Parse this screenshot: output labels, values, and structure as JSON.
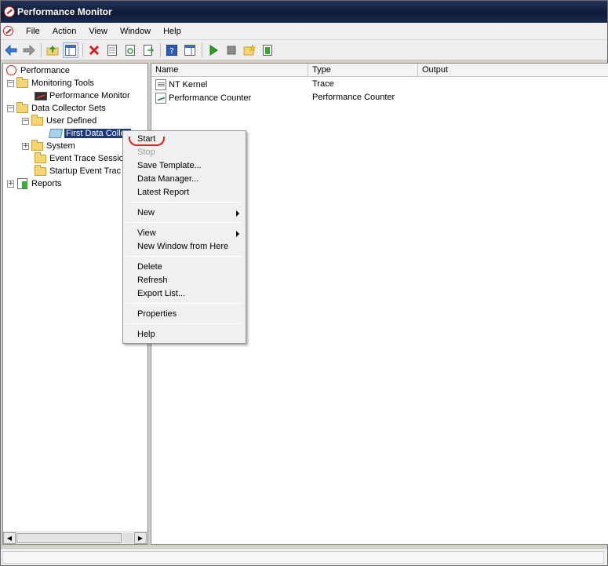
{
  "window": {
    "title": "Performance Monitor"
  },
  "menubar": {
    "items": [
      "File",
      "Action",
      "View",
      "Window",
      "Help"
    ]
  },
  "toolbar": {
    "buttons": [
      "back-icon",
      "forward-icon",
      "up-folder-icon",
      "show-hide-tree-icon",
      "delete-icon",
      "properties-icon",
      "refresh-icon",
      "export-icon",
      "help-icon",
      "show-action-pane-icon",
      "start-icon",
      "stop-icon",
      "new-collector-icon",
      "latest-report-icon"
    ]
  },
  "tree": {
    "root": "Performance",
    "monitoring_tools": "Monitoring Tools",
    "performance_monitor": "Performance Monitor",
    "data_collector_sets": "Data Collector Sets",
    "user_defined": "User Defined",
    "first_data_collector": "First Data Collec",
    "system": "System",
    "event_trace_sessions": "Event Trace Sessio",
    "startup_event_trace": "Startup Event Trac",
    "reports": "Reports"
  },
  "list": {
    "columns": [
      "Name",
      "Type",
      "Output"
    ],
    "rows": [
      {
        "name": "NT Kernel",
        "type": "Trace",
        "output": ""
      },
      {
        "name": "Performance Counter",
        "type": "Performance Counter",
        "output": ""
      }
    ]
  },
  "context_menu": {
    "start": "Start",
    "stop": "Stop",
    "save_template": "Save Template...",
    "data_manager": "Data Manager...",
    "latest_report": "Latest Report",
    "new": "New",
    "view": "View",
    "new_window": "New Window from Here",
    "delete": "Delete",
    "refresh": "Refresh",
    "export_list": "Export List...",
    "properties": "Properties",
    "help": "Help"
  },
  "colors": {
    "titlebar": "#0e1a36",
    "selection": "#1e3a7b",
    "annotation": "#e02020",
    "start_green": "#22a522"
  }
}
